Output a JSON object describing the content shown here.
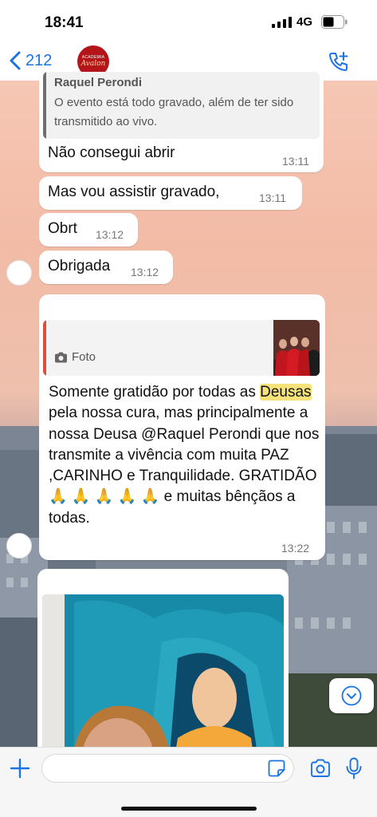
{
  "status_bar": {
    "time": "18:41",
    "network": "4G"
  },
  "header": {
    "back_count": "212",
    "avatar_text_top": "ACADEMIA",
    "avatar_text_bottom": "Avalon"
  },
  "messages": {
    "quoted": {
      "author": "Raquel Perondi",
      "text": "O evento está todo gravado, além de ter sido transmitido ao vivo."
    },
    "m1": {
      "text": "Não consegui abrir",
      "time": "13:11"
    },
    "m2": {
      "text": "Mas vou assistir gravado,",
      "time": "13:11"
    },
    "m3": {
      "text": "Obrt",
      "time": "13:12"
    },
    "m4": {
      "text": "Obrigada",
      "time": "13:12"
    },
    "m5": {
      "reply_label": "Foto",
      "text_before": "Somente gratidão por todas as ",
      "highlight": "Deusas",
      "text_after": " pela nossa cura, mas principalmente a nossa Deusa @Raquel Perondi que nos transmite a vivência com muita PAZ ,CARINHO e Tranquilidade. GRATIDÃO 🙏 🙏 🙏 🙏 🙏 e muitas bênçãos a todas.",
      "time": "13:22"
    }
  },
  "colors": {
    "accent": "#1b74e4",
    "highlight": "#f6e27a",
    "quote_bar": "#e04a3f",
    "bubble": "#ffffff"
  },
  "icons": [
    "back-chevron-icon",
    "phone-plus-icon",
    "camera-icon",
    "plus-icon",
    "sticker-icon",
    "mic-icon",
    "chevron-down-icon"
  ]
}
